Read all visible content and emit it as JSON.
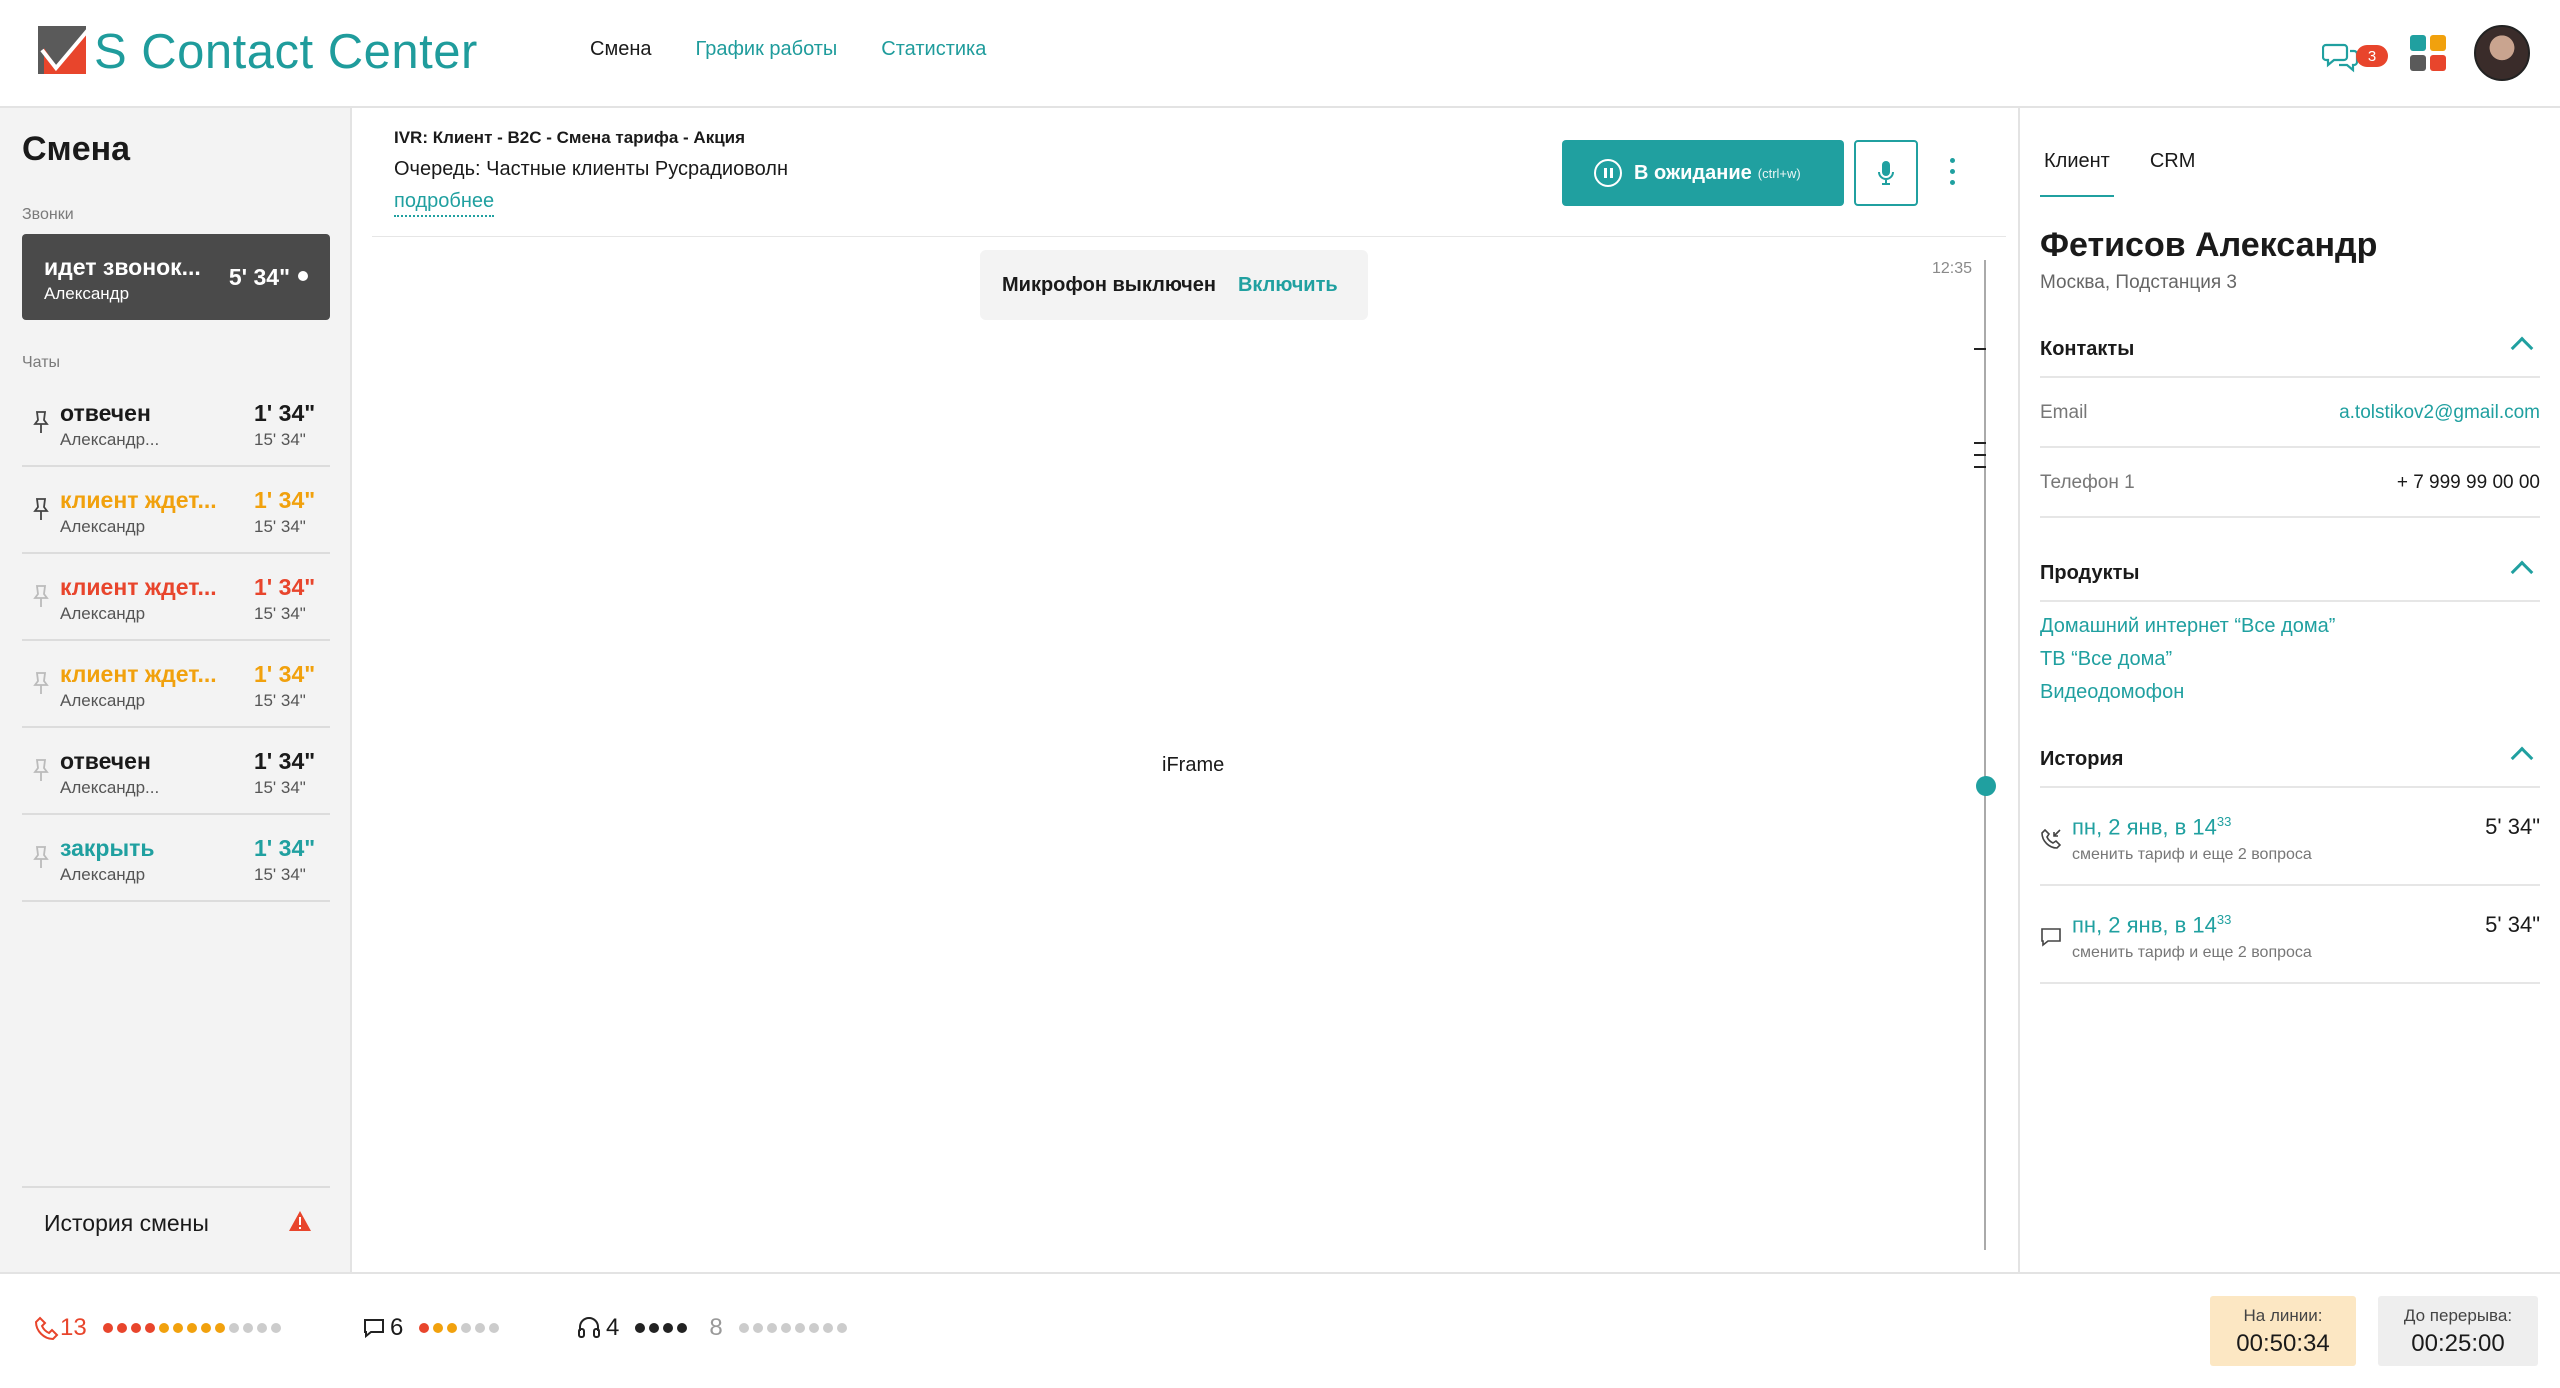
{
  "header": {
    "logo_text": "S Contact Center",
    "nav": [
      {
        "label": "Смена",
        "active": true
      },
      {
        "label": "График работы",
        "active": false
      },
      {
        "label": "Статистика",
        "active": false
      }
    ],
    "chat_badge": "3",
    "icons": {
      "chat": "chat-bubbles-icon",
      "apps": "apps-grid-icon"
    },
    "colors": {
      "accent": "#20a0a0",
      "badge": "#e8452c",
      "orange": "#f1a10d"
    }
  },
  "left": {
    "title": "Смена",
    "calls_label": "Звонки",
    "active_call": {
      "status": "идет звонок...",
      "name": "Александр",
      "time": "5' 34\""
    },
    "chats_label": "Чаты",
    "chats": [
      {
        "status": "отвечен",
        "name": "Александр...",
        "t1": "1' 34\"",
        "t2": "15' 34\"",
        "color": "black"
      },
      {
        "status": "клиент ждет...",
        "name": "Александр",
        "t1": "1' 34\"",
        "t2": "15' 34\"",
        "color": "orange"
      },
      {
        "status": "клиент ждет...",
        "name": "Александр",
        "t1": "1' 34\"",
        "t2": "15' 34\"",
        "color": "red"
      },
      {
        "status": "клиент ждет...",
        "name": "Александр",
        "t1": "1' 34\"",
        "t2": "15' 34\"",
        "color": "orange"
      },
      {
        "status": "отвечен",
        "name": "Александр...",
        "t1": "1' 34\"",
        "t2": "15' 34\"",
        "color": "black"
      },
      {
        "status": "закрыть",
        "name": "Александр",
        "t1": "1' 34\"",
        "t2": "15' 34\"",
        "color": "teal"
      }
    ],
    "history_label": "История смены"
  },
  "center": {
    "ivr": "IVR: Клиент - B2C - Смена тарифа - Акция",
    "queue": "Очередь: Частные клиенты Русрадиоволн",
    "more_link": "подробнее",
    "wait_button": "В ожидание",
    "wait_hint": "(ctrl+w)",
    "mic_off_label": "Микрофон выключен",
    "mic_enable": "Включить",
    "time": "12:35",
    "iframe_label": "iFrame"
  },
  "right": {
    "tabs": [
      "Клиент",
      "CRM"
    ],
    "client_name": "Фетисов Александр",
    "client_address": "Москва, Подстанция 3",
    "contacts_title": "Контакты",
    "contacts": [
      {
        "key": "Email",
        "value": "a.tolstikov2@gmail.com"
      },
      {
        "key": "Телефон 1",
        "value": "+ 7 999 99 00 00"
      }
    ],
    "products_title": "Продукты",
    "products": [
      "Домашний интернет “Все дома”",
      "ТВ “Все дома”",
      "Видеодомофон"
    ],
    "history_title": "История",
    "history": [
      {
        "icon": "phone-incoming-icon",
        "date": "пн, 2 янв, в 14",
        "sup": "33",
        "subject": "сменить тариф и еще 2 вопроса",
        "duration": "5' 34\""
      },
      {
        "icon": "chat-icon",
        "date": "пн, 2 янв, в 14",
        "sup": "33",
        "subject": "сменить тариф и еще 2 вопроса",
        "duration": "5' 34\""
      }
    ]
  },
  "footer": {
    "calls_count": "13",
    "chats_count": "6",
    "agents_count": "4",
    "queue_count": "8",
    "online_label": "На линии:",
    "online_time": "00:50:34",
    "break_label": "До перерыва:",
    "break_time": "00:25:00"
  }
}
